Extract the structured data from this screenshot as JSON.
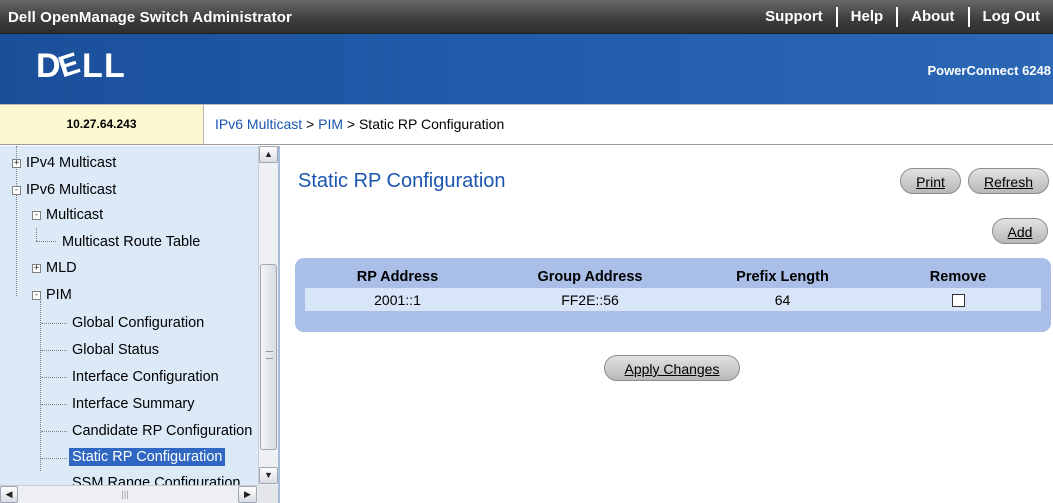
{
  "header": {
    "app_title": "Dell OpenManage Switch Administrator",
    "nav": [
      "Support",
      "Help",
      "About",
      "Log Out"
    ],
    "product": "PowerConnect 6248"
  },
  "logo_text": "DELL",
  "ip_address": "10.27.64.243",
  "breadcrumb": {
    "items": [
      "IPv6 Multicast",
      "PIM"
    ],
    "separator": ">",
    "current": "Static RP Configuration"
  },
  "tree": {
    "items": [
      {
        "label": "IPv4 Multicast",
        "expander": "+"
      },
      {
        "label": "IPv6 Multicast",
        "expander": "-"
      },
      {
        "label": "Multicast",
        "expander": "-"
      },
      {
        "label": "Multicast Route Table",
        "expander": ""
      },
      {
        "label": "MLD",
        "expander": "+"
      },
      {
        "label": "PIM",
        "expander": "-"
      },
      {
        "label": "Global Configuration",
        "expander": ""
      },
      {
        "label": "Global Status",
        "expander": ""
      },
      {
        "label": "Interface Configuration",
        "expander": ""
      },
      {
        "label": "Interface Summary",
        "expander": ""
      },
      {
        "label": "Candidate RP Configuration",
        "expander": ""
      },
      {
        "label": "Static RP Configuration",
        "expander": "",
        "selected": true
      },
      {
        "label": "SSM Range Configuration",
        "expander": ""
      }
    ]
  },
  "page": {
    "title": "Static RP Configuration",
    "buttons": {
      "print": "Print",
      "refresh": "Refresh",
      "add": "Add",
      "apply": "Apply Changes"
    }
  },
  "table": {
    "columns": [
      "RP Address",
      "Group Address",
      "Prefix Length",
      "Remove"
    ],
    "rows": [
      {
        "rp_address": "2001::1",
        "group_address": "FF2E::56",
        "prefix_length": "64",
        "remove": false
      }
    ]
  },
  "colors": {
    "banner": "#1f5aa8",
    "link": "#1a56b0",
    "tree_bg": "#dceaf8",
    "selected": "#2f67c2",
    "table_frame": "#a9bfe7"
  }
}
